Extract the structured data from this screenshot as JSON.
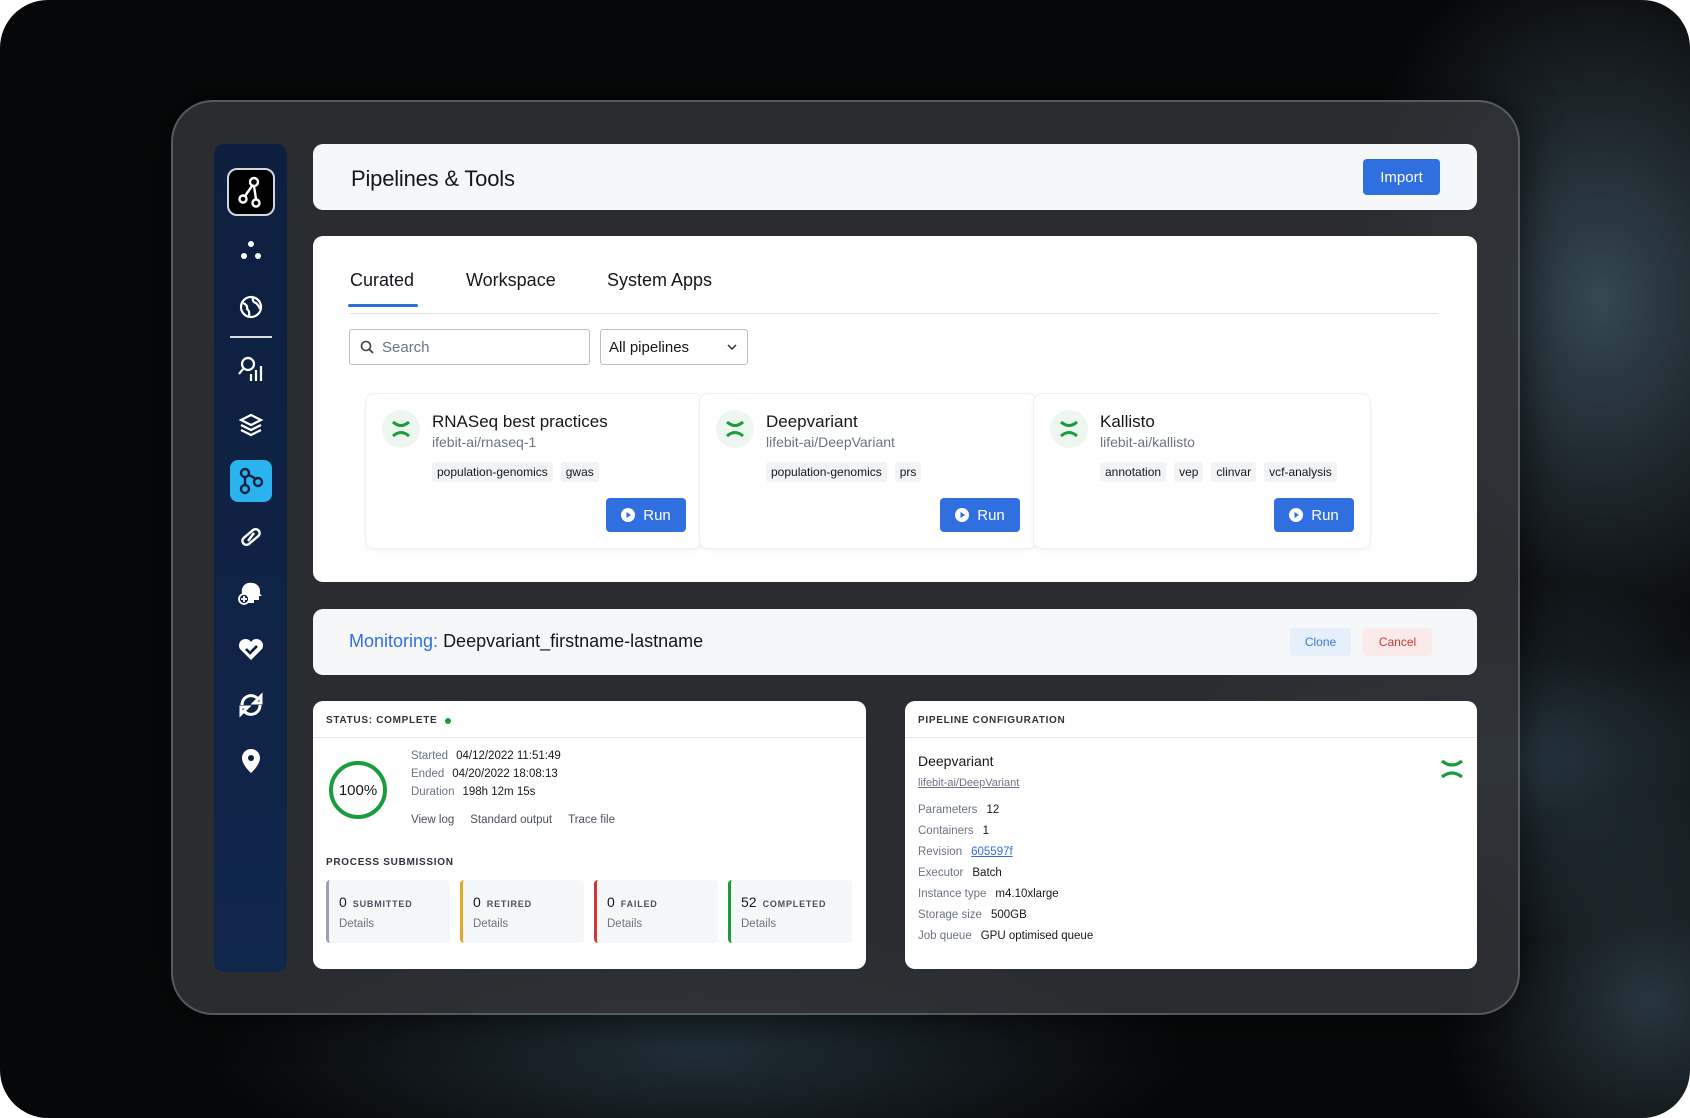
{
  "header": {
    "title": "Pipelines & Tools",
    "import_label": "Import"
  },
  "sidebar": {
    "items": [
      {
        "icon": "dots-cluster-icon"
      },
      {
        "icon": "globe-icon"
      },
      {
        "icon": "analytics-icon"
      },
      {
        "icon": "layers-icon"
      },
      {
        "icon": "pipeline-icon",
        "active": true
      },
      {
        "icon": "pill-icon"
      },
      {
        "icon": "head-plus-icon"
      },
      {
        "icon": "heart-check-icon"
      },
      {
        "icon": "sync-icon"
      },
      {
        "icon": "location-pin-icon"
      }
    ]
  },
  "tabs": [
    "Curated",
    "Workspace",
    "System Apps"
  ],
  "search": {
    "placeholder": "Search"
  },
  "filter": {
    "selected": "All pipelines"
  },
  "pipelines": [
    {
      "title": "RNASeq best practices",
      "repo": "ifebit-ai/rnaseq-1",
      "tags": [
        "population-genomics",
        "gwas"
      ],
      "run_label": "Run"
    },
    {
      "title": "Deepvariant",
      "repo": "lifebit-ai/DeepVariant",
      "tags": [
        "population-genomics",
        "prs"
      ],
      "run_label": "Run"
    },
    {
      "title": "Kallisto",
      "repo": "lifebit-ai/kallisto",
      "tags": [
        "annotation",
        "vep",
        "clinvar",
        "vcf-analysis"
      ],
      "run_label": "Run"
    }
  ],
  "monitoring": {
    "label": "Monitoring:",
    "job": "Deepvariant_firstname-lastname",
    "clone_label": "Clone",
    "cancel_label": "Cancel"
  },
  "status": {
    "heading": "STATUS: COMPLETE",
    "progress": "100%",
    "started_k": "Started",
    "started_v": "04/12/2022 11:51:49",
    "ended_k": "Ended",
    "ended_v": "04/20/2022 18:08:13",
    "duration_k": "Duration",
    "duration_v": "198h 12m 15s",
    "links": [
      "View log",
      "Standard output",
      "Trace file"
    ],
    "submission_heading": "PROCESS SUBMISSION",
    "tiles": [
      {
        "num": "0",
        "label": "Submitted",
        "details": "Details",
        "color": "#9ca3ad"
      },
      {
        "num": "0",
        "label": "Retired",
        "details": "Details",
        "color": "#e2a92b"
      },
      {
        "num": "0",
        "label": "Failed",
        "details": "Details",
        "color": "#d0373a"
      },
      {
        "num": "52",
        "label": "Completed",
        "details": "Details",
        "color": "#1a9b3c"
      }
    ]
  },
  "config": {
    "heading": "PIPELINE CONFIGURATION",
    "title": "Deepvariant",
    "repo": "lifebit-ai/DeepVariant",
    "rows": [
      {
        "k": "Parameters",
        "v": "12"
      },
      {
        "k": "Containers",
        "v": "1"
      },
      {
        "k": "Revision",
        "v": "605597f"
      },
      {
        "k": "Executor",
        "v": "Batch"
      },
      {
        "k": "Instance type",
        "v": "m4.10xlarge"
      },
      {
        "k": "Storage size",
        "v": "500GB"
      },
      {
        "k": "Job queue",
        "v": "GPU optimised queue"
      }
    ]
  },
  "colors": {
    "accent": "#2f6fe0",
    "brand_green": "#1a9b3c",
    "sidebar": "#0d1f3f",
    "active_nav": "#2ab3ee"
  }
}
